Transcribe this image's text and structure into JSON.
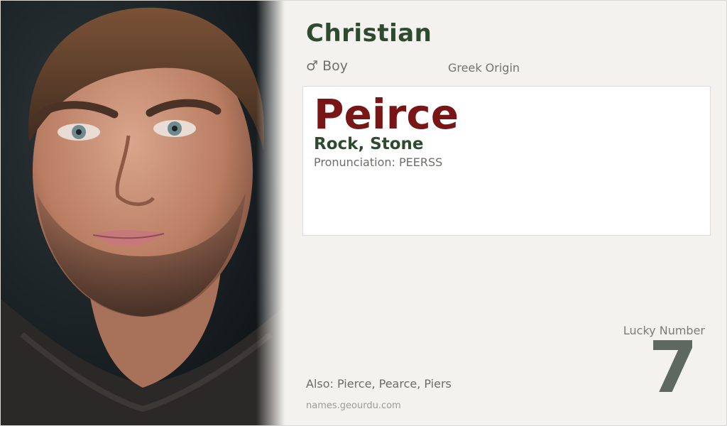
{
  "profile": {
    "name": "Christian",
    "gender_icon": "male-symbol-icon",
    "gender_symbol": "♂",
    "gender_label": "Boy",
    "origin": "Greek Origin"
  },
  "card": {
    "name": "Peirce",
    "meaning": "Rock, Stone",
    "pronunciation": "Pronunciation: PEERSS"
  },
  "lucky": {
    "label": "Lucky Number",
    "number": "7"
  },
  "also": "Also: Pierce, Pearce, Piers",
  "site": "names.geourdu.com",
  "colors": {
    "background": "#f3f2ee",
    "title_green": "#2e4b2f",
    "name_red": "#7a1515",
    "lucky_gray": "#5e6760"
  }
}
